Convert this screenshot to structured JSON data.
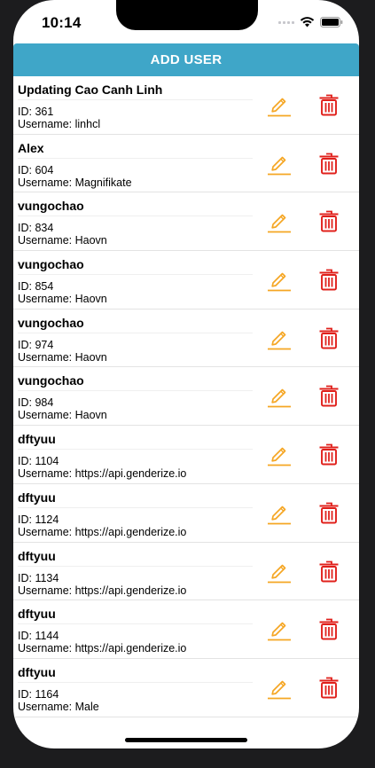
{
  "status_bar": {
    "time": "10:14"
  },
  "toolbar": {
    "add_user_label": "ADD USER"
  },
  "users": [
    {
      "name": "Updating Cao Canh Linh",
      "id": "ID: 361",
      "username": "Username: linhcl"
    },
    {
      "name": "Alex",
      "id": "ID: 604",
      "username": "Username: Magnifikate"
    },
    {
      "name": "vungochao",
      "id": "ID: 834",
      "username": "Username: Haovn"
    },
    {
      "name": "vungochao",
      "id": "ID: 854",
      "username": "Username: Haovn"
    },
    {
      "name": "vungochao",
      "id": "ID: 974",
      "username": "Username: Haovn"
    },
    {
      "name": "vungochao",
      "id": "ID: 984",
      "username": "Username: Haovn"
    },
    {
      "name": "dftyuu",
      "id": "ID: 1104",
      "username": "Username: https://api.genderize.io"
    },
    {
      "name": "dftyuu",
      "id": "ID: 1124",
      "username": "Username: https://api.genderize.io"
    },
    {
      "name": "dftyuu",
      "id": "ID: 1134",
      "username": "Username: https://api.genderize.io"
    },
    {
      "name": "dftyuu",
      "id": "ID: 1144",
      "username": "Username: https://api.genderize.io"
    },
    {
      "name": "dftyuu",
      "id": "ID: 1164",
      "username": "Username: Male"
    }
  ],
  "icons": {
    "edit": "pencil-icon",
    "delete": "trash-icon"
  },
  "colors": {
    "accent": "#3fa6c8",
    "edit": "#f5a623",
    "delete": "#e0201b"
  }
}
